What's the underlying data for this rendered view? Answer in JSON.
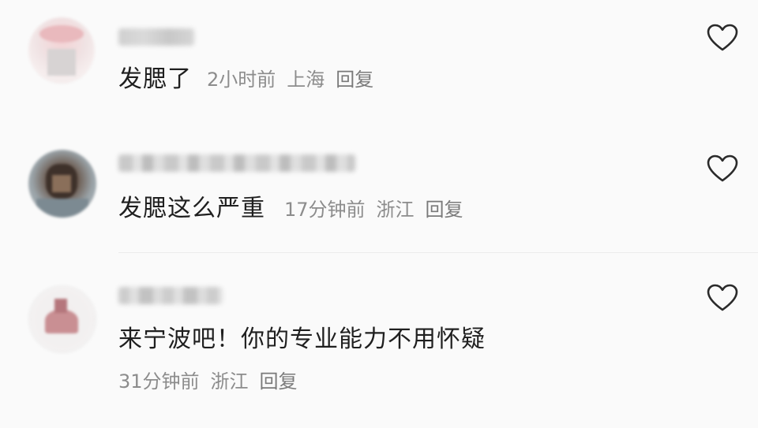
{
  "comments": [
    {
      "content": "发腮了",
      "time": "2小时前",
      "location": "上海",
      "reply_label": "回复"
    },
    {
      "content": "发腮这么严重",
      "time": "17分钟前",
      "location": "浙江",
      "reply_label": "回复"
    },
    {
      "content": "来宁波吧！你的专业能力不用怀疑",
      "time": "31分钟前",
      "location": "浙江",
      "reply_label": "回复"
    }
  ],
  "icons": {
    "like": "heart-outline-icon"
  },
  "colors": {
    "background": "#fafafa",
    "content_text": "#1f1f1f",
    "meta_text": "#8c8c8c"
  }
}
